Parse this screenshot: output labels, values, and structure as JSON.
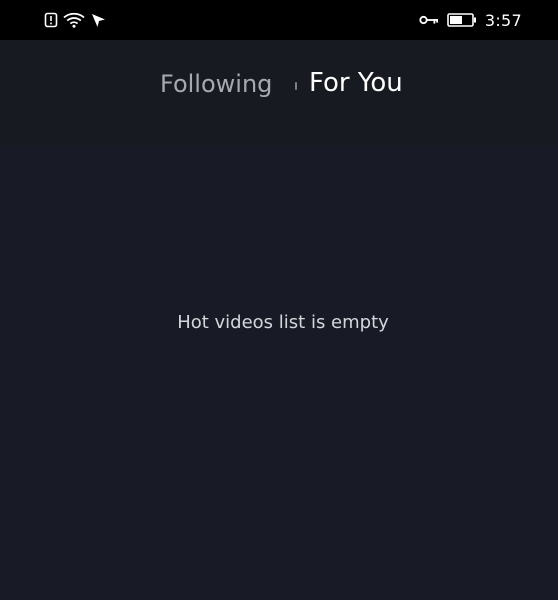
{
  "status_bar": {
    "left_icons": [
      "notification-sim-icon",
      "wifi-icon",
      "location-arrow-icon"
    ],
    "right_icons": [
      "vpn-key-icon",
      "battery-icon"
    ],
    "time": "3:57"
  },
  "header": {
    "tabs": [
      {
        "label": "Following",
        "active": false
      },
      {
        "label": "For You",
        "active": true
      }
    ]
  },
  "main": {
    "empty_message": "Hot videos list is empty"
  },
  "colors": {
    "status_bar_bg": "#000000",
    "header_bg": "#181a22",
    "content_bg": "#181b26",
    "active_tab": "#ffffff",
    "inactive_tab": "#a7a9b2"
  }
}
